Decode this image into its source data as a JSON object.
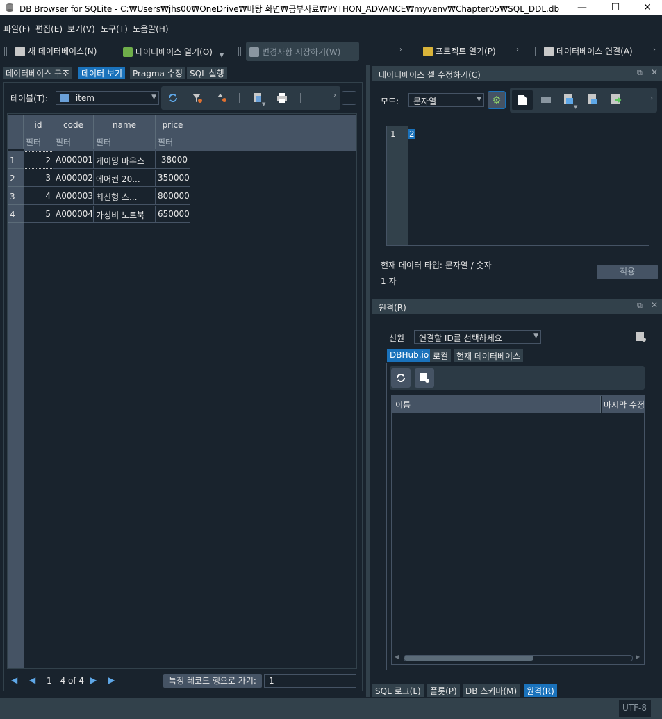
{
  "window": {
    "title": "DB Browser for SQLite - C:₩Users₩jhs00₩OneDrive₩바탕 화면₩공부자료₩PYTHON_ADVANCE₩myvenv₩Chapter05₩SQL_DDL.db",
    "minimize": "—",
    "maximize": "☐",
    "close": "✕"
  },
  "menu": [
    "파일(F)",
    "편집(E)",
    "보기(V)",
    "도구(T)",
    "도움말(H)"
  ],
  "toolbar": {
    "new_db": "새 데이터베이스(N)",
    "open_db": "데이터베이스 열기(O)",
    "write_changes": "변경사항 저장하기(W)",
    "open_project": "프로젝트 열기(P)",
    "attach_db": "데이터베이스 연결(A)"
  },
  "left_tabs": [
    "데이터베이스 구조",
    "데이터 보기",
    "Pragma 수정",
    "SQL 실행"
  ],
  "browse": {
    "table_label": "테이블(T):",
    "table_value": "item"
  },
  "table": {
    "columns": [
      "id",
      "code",
      "name",
      "price"
    ],
    "filter_placeholder": "필터",
    "rows": [
      {
        "num": "1",
        "id": "2",
        "code": "A000001",
        "name": "게이밍 마우스",
        "price": "38000"
      },
      {
        "num": "2",
        "id": "3",
        "code": "A000002",
        "name": "에어컨 20...",
        "price": "350000"
      },
      {
        "num": "3",
        "id": "4",
        "code": "A000003",
        "name": "최신형 스...",
        "price": "800000"
      },
      {
        "num": "4",
        "id": "5",
        "code": "A000004",
        "name": "가성비 노트북",
        "price": "650000"
      }
    ]
  },
  "navigation": {
    "first": "◀",
    "prev": "◀",
    "range": "1 - 4 of 4",
    "next": "▶",
    "last": "▶",
    "goto_label": "특정 레코드 행으로 가기:",
    "goto_value": "1"
  },
  "edit_cell": {
    "title": "데이터베이스 셀 수정하기(C)",
    "mode_label": "모드:",
    "mode_value": "문자열",
    "line_no": "1",
    "content": "2",
    "type_info": "현재 데이터 타입: 문자열 / 숫자",
    "size_info": "1 자",
    "apply": "적용"
  },
  "remote": {
    "title": "원격(R)",
    "identity_label": "신원",
    "identity_value": "연결할 ID를 선택하세요",
    "tabs": [
      "DBHub.io",
      "로컬",
      "현재 데이터베이스"
    ],
    "col_name": "이름",
    "col_modified": "마지막 수정"
  },
  "bottom_tabs": [
    "SQL 로그(L)",
    "플롯(P)",
    "DB 스키마(M)",
    "원격(R)"
  ],
  "status": {
    "encoding": "UTF-8"
  },
  "colors": {
    "background": "#19232d",
    "panel": "#32414b",
    "header": "#455364",
    "accent": "#1a72bb"
  }
}
